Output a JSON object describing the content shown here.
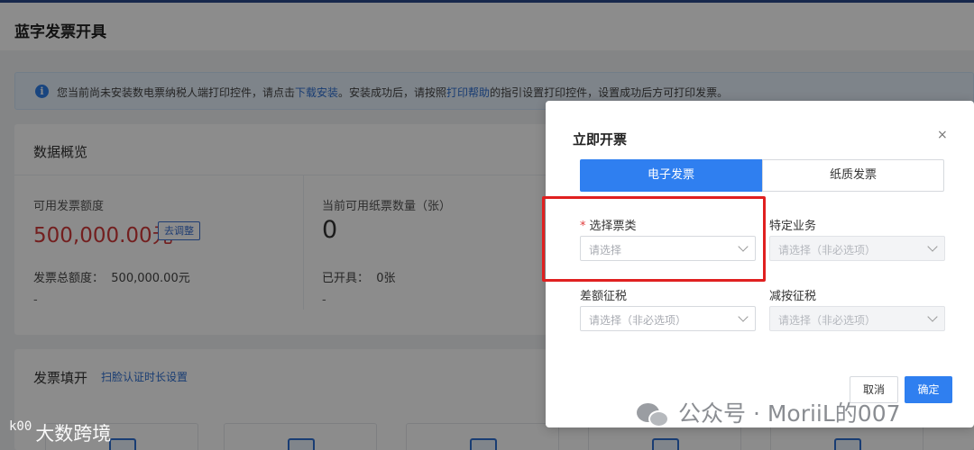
{
  "page": {
    "title": "蓝字发票开具"
  },
  "banner": {
    "icon": "info-icon",
    "text_1": "您当前尚未安装数电票纳税人端打印控件，请点击",
    "download_link": "下载安装",
    "text_2": "。安装成功后，请按照",
    "help_link": "打印帮助",
    "text_3": "的指引设置打印控件，设置成功后方可打印发票。"
  },
  "overview": {
    "title": "数据概览",
    "quota": {
      "label": "可用发票额度",
      "value": "500,000.00元",
      "adjust_label": "去调整"
    },
    "paper": {
      "label": "当前可用纸票数量（张）",
      "value": "0"
    },
    "total": {
      "label": "发票总额度：",
      "value": "500,000.00元",
      "dash": "-"
    },
    "issued": {
      "label": "已开具：",
      "value": "0张",
      "dash": "-"
    }
  },
  "fill": {
    "title": "发票填开",
    "link": "扫脸认证时长设置"
  },
  "dialog": {
    "title": "立即开票",
    "close": "×",
    "tabs": [
      {
        "label": "电子发票",
        "active": true
      },
      {
        "label": "纸质发票",
        "active": false
      }
    ],
    "fields": {
      "ticket_type": {
        "required_mark": "*",
        "label": "选择票类",
        "placeholder": "请选择"
      },
      "special_business": {
        "label": "特定业务",
        "placeholder": "请选择（非必选项）",
        "disabled": true
      },
      "diff_tax": {
        "label": "差额征税",
        "placeholder": "请选择（非必选项）"
      },
      "reduced_tax": {
        "label": "减按征税",
        "placeholder": "请选择（非必选项）",
        "disabled": true
      }
    },
    "cancel_label": "取消",
    "ok_label": "确定"
  },
  "watermarks": {
    "left_mini": "k00",
    "left": "大数跨境",
    "right": "公众号 · MoriiL的007",
    "right_icon": "wechat-icon"
  },
  "colors": {
    "primary": "#2f7ff0",
    "danger": "#e02020",
    "amount_red": "#d23a3a"
  }
}
